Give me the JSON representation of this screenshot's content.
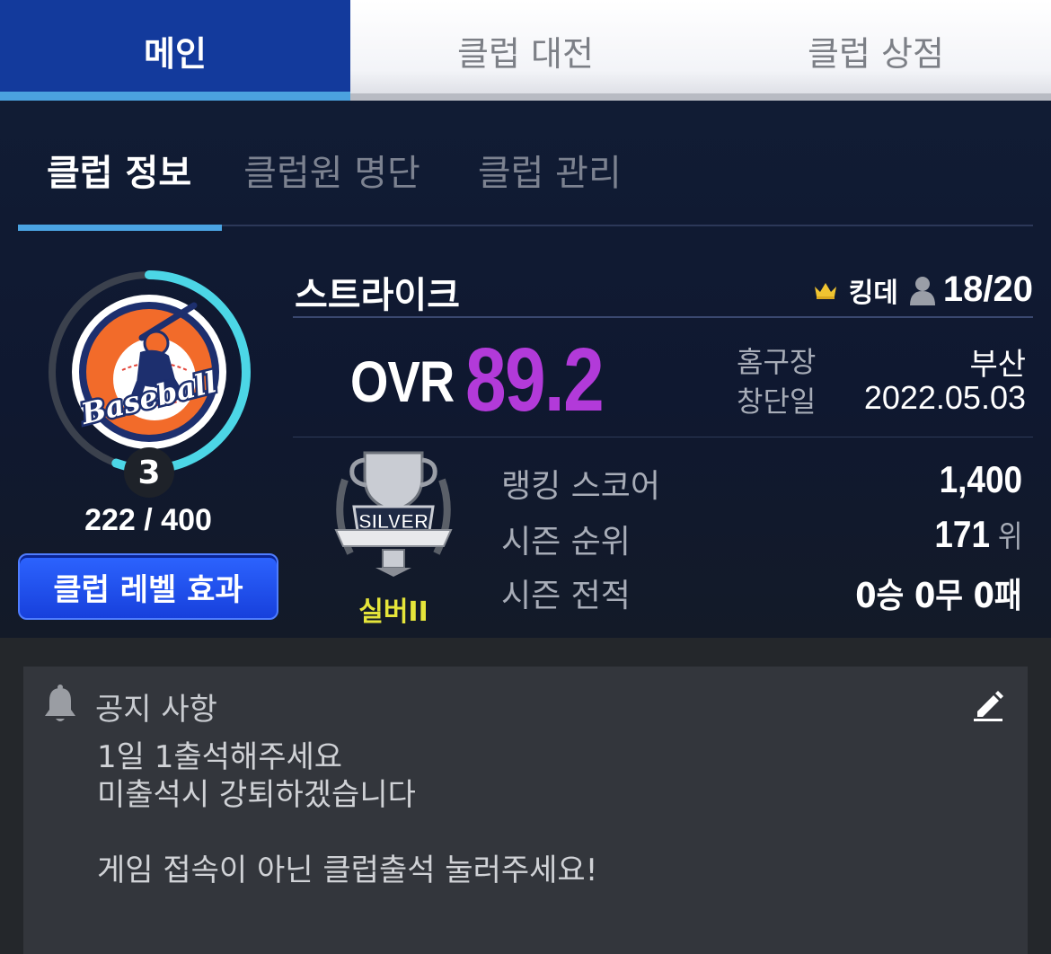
{
  "top_tabs": [
    {
      "label": "메인",
      "active": true
    },
    {
      "label": "클럽 대전",
      "active": false
    },
    {
      "label": "클럽 상점",
      "active": false
    }
  ],
  "sub_tabs": [
    {
      "label": "클럽 정보",
      "active": true
    },
    {
      "label": "클럽원 명단",
      "active": false
    },
    {
      "label": "클럽 관리",
      "active": false
    }
  ],
  "club": {
    "emblem_text": "Baseball",
    "level": "3",
    "exp_text": "222 / 400",
    "exp_progress": 0.555,
    "level_effect_label": "클럽 레벨 효과",
    "name": "스트라이크",
    "leader_name": "킹데",
    "members": "18/20",
    "ovr_label": "OVR",
    "ovr_value": "89.2",
    "home_label": "홈구장",
    "home_value": "부산",
    "founded_label": "창단일",
    "founded_value": "2022.05.03",
    "tier_emblem_text": "SILVER",
    "tier_name": "실버II",
    "ranking_score_label": "랭킹 스코어",
    "ranking_score_value": "1,400",
    "season_rank_label": "시즌 순위",
    "season_rank_value": "171",
    "season_rank_unit": "위",
    "season_record_label": "시즌 전적",
    "season_record_value": "0승 0무 0패"
  },
  "notice": {
    "title": "공지 사항",
    "lines": [
      "1일 1출석해주세요",
      "미출석시 강퇴하겠습니다",
      "",
      "게임 접속이 아닌 클럽출석 눌러주세요!"
    ]
  },
  "colors": {
    "active_tab": "#133a9c",
    "tab_indicator": "#4ba2df",
    "ovr": "#b23ad9",
    "tier_name": "#e5e53a",
    "progress_ring": "#4cd6e6"
  },
  "icons": [
    "crown-icon",
    "person-icon",
    "bell-icon",
    "edit-icon",
    "baseball-emblem",
    "silver-trophy-emblem"
  ]
}
